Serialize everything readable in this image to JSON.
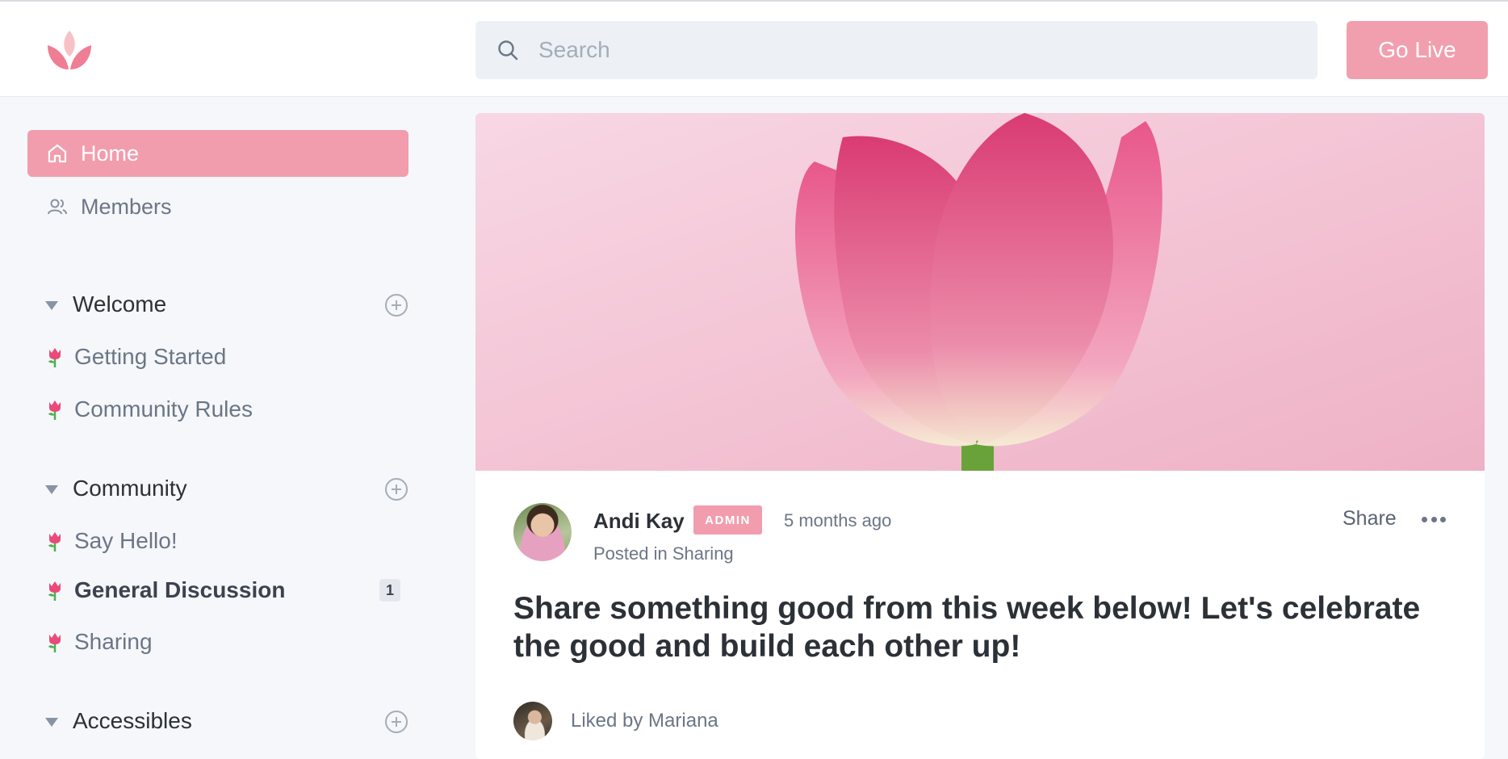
{
  "header": {
    "logo": "lotus-logo",
    "search_placeholder": "Search",
    "go_live_label": "Go Live"
  },
  "sidebar": {
    "nav": [
      {
        "label": "Home",
        "icon": "home-icon",
        "active": true
      },
      {
        "label": "Members",
        "icon": "members-icon",
        "active": false
      }
    ],
    "sections": [
      {
        "title": "Welcome",
        "items": [
          {
            "label": "Getting Started",
            "emoji": "tulip"
          },
          {
            "label": "Community Rules",
            "emoji": "tulip"
          }
        ]
      },
      {
        "title": "Community",
        "items": [
          {
            "label": "Say Hello!",
            "emoji": "tulip"
          },
          {
            "label": "General Discussion",
            "emoji": "tulip",
            "unread": "1"
          },
          {
            "label": "Sharing",
            "emoji": "tulip"
          }
        ]
      },
      {
        "title": "Accessibles",
        "items": []
      }
    ]
  },
  "post": {
    "author": "Andi Kay",
    "badge": "ADMIN",
    "time_ago": "5 months ago",
    "posted_in": "Posted in Sharing",
    "share_label": "Share",
    "title": "Share something good from this week below! Let's celebrate the good and build each other up!",
    "liked_by": "Liked by Mariana"
  },
  "colors": {
    "accent": "#f19dad",
    "background": "#f5f7fa",
    "muted_text": "#6b7686"
  }
}
